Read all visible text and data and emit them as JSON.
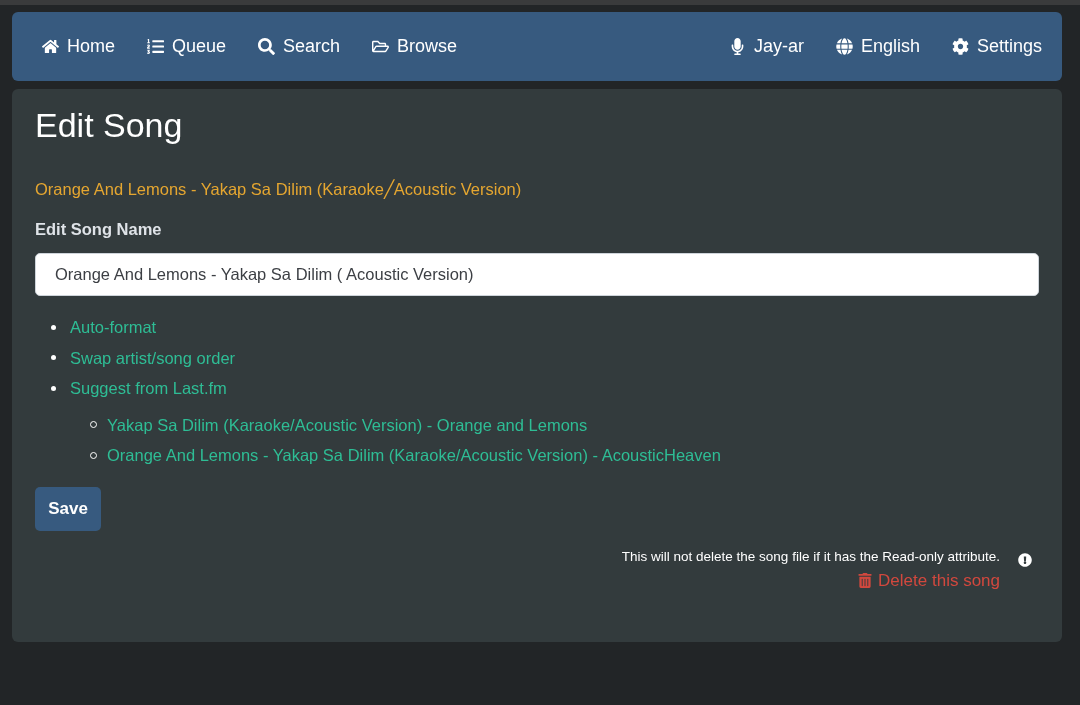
{
  "navbar": {
    "left_links": [
      {
        "label": "Home"
      },
      {
        "label": "Queue"
      },
      {
        "label": "Search"
      },
      {
        "label": "Browse"
      }
    ],
    "right_links": [
      {
        "label": "Jay-ar"
      },
      {
        "label": "English"
      },
      {
        "label": "Settings"
      }
    ]
  },
  "page": {
    "title": "Edit Song",
    "current_name": "Orange And Lemons - Yakap Sa Dilim (Karaoke╱Acoustic Version)",
    "field_label": "Edit Song Name",
    "name_field": {
      "value": "Orange And Lemons - Yakap Sa Dilim ( Acoustic Version)"
    },
    "actions": [
      {
        "label": "Auto-format"
      },
      {
        "label": "Swap artist/song order"
      },
      {
        "label": "Suggest from Last.fm",
        "children": [
          {
            "label": "Yakap Sa Dilim (Karaoke/Acoustic Version) - Orange and Lemons"
          },
          {
            "label": "Orange And Lemons - Yakap Sa Dilim (Karaoke/Acoustic Version) - AcousticHeaven"
          }
        ]
      }
    ],
    "save_button": "Save",
    "delete_note": "This will not delete the song file if it has the Read-only attribute.",
    "delete_link": "Delete this song"
  }
}
